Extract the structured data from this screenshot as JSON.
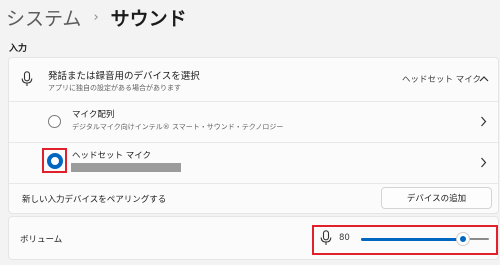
{
  "breadcrumb": {
    "parent": "システム",
    "separator": "›",
    "current": "サウンド"
  },
  "input_section": {
    "label": "入力",
    "header": {
      "title": "発話または録音用のデバイスを選択",
      "subtitle": "アプリに独自の設定がある場合があります",
      "selected_value": "ヘッドセット マイク",
      "icon": "microphone-icon",
      "expand_icon": "chevron-up-icon"
    },
    "devices": [
      {
        "name": "マイク配列",
        "description": "デジタルマイク向けインテル® スマート・サウンド・テクノロジー",
        "selected": false
      },
      {
        "name": "ヘッドセット マイク",
        "description": "",
        "selected": true
      }
    ],
    "pair": {
      "label": "新しい入力デバイスをペアリングする",
      "button": "デバイスの追加"
    }
  },
  "volume": {
    "label": "ボリューム",
    "value": "80",
    "level": 0.8
  },
  "colors": {
    "accent": "#0067c0",
    "highlight": "#e0202a"
  }
}
